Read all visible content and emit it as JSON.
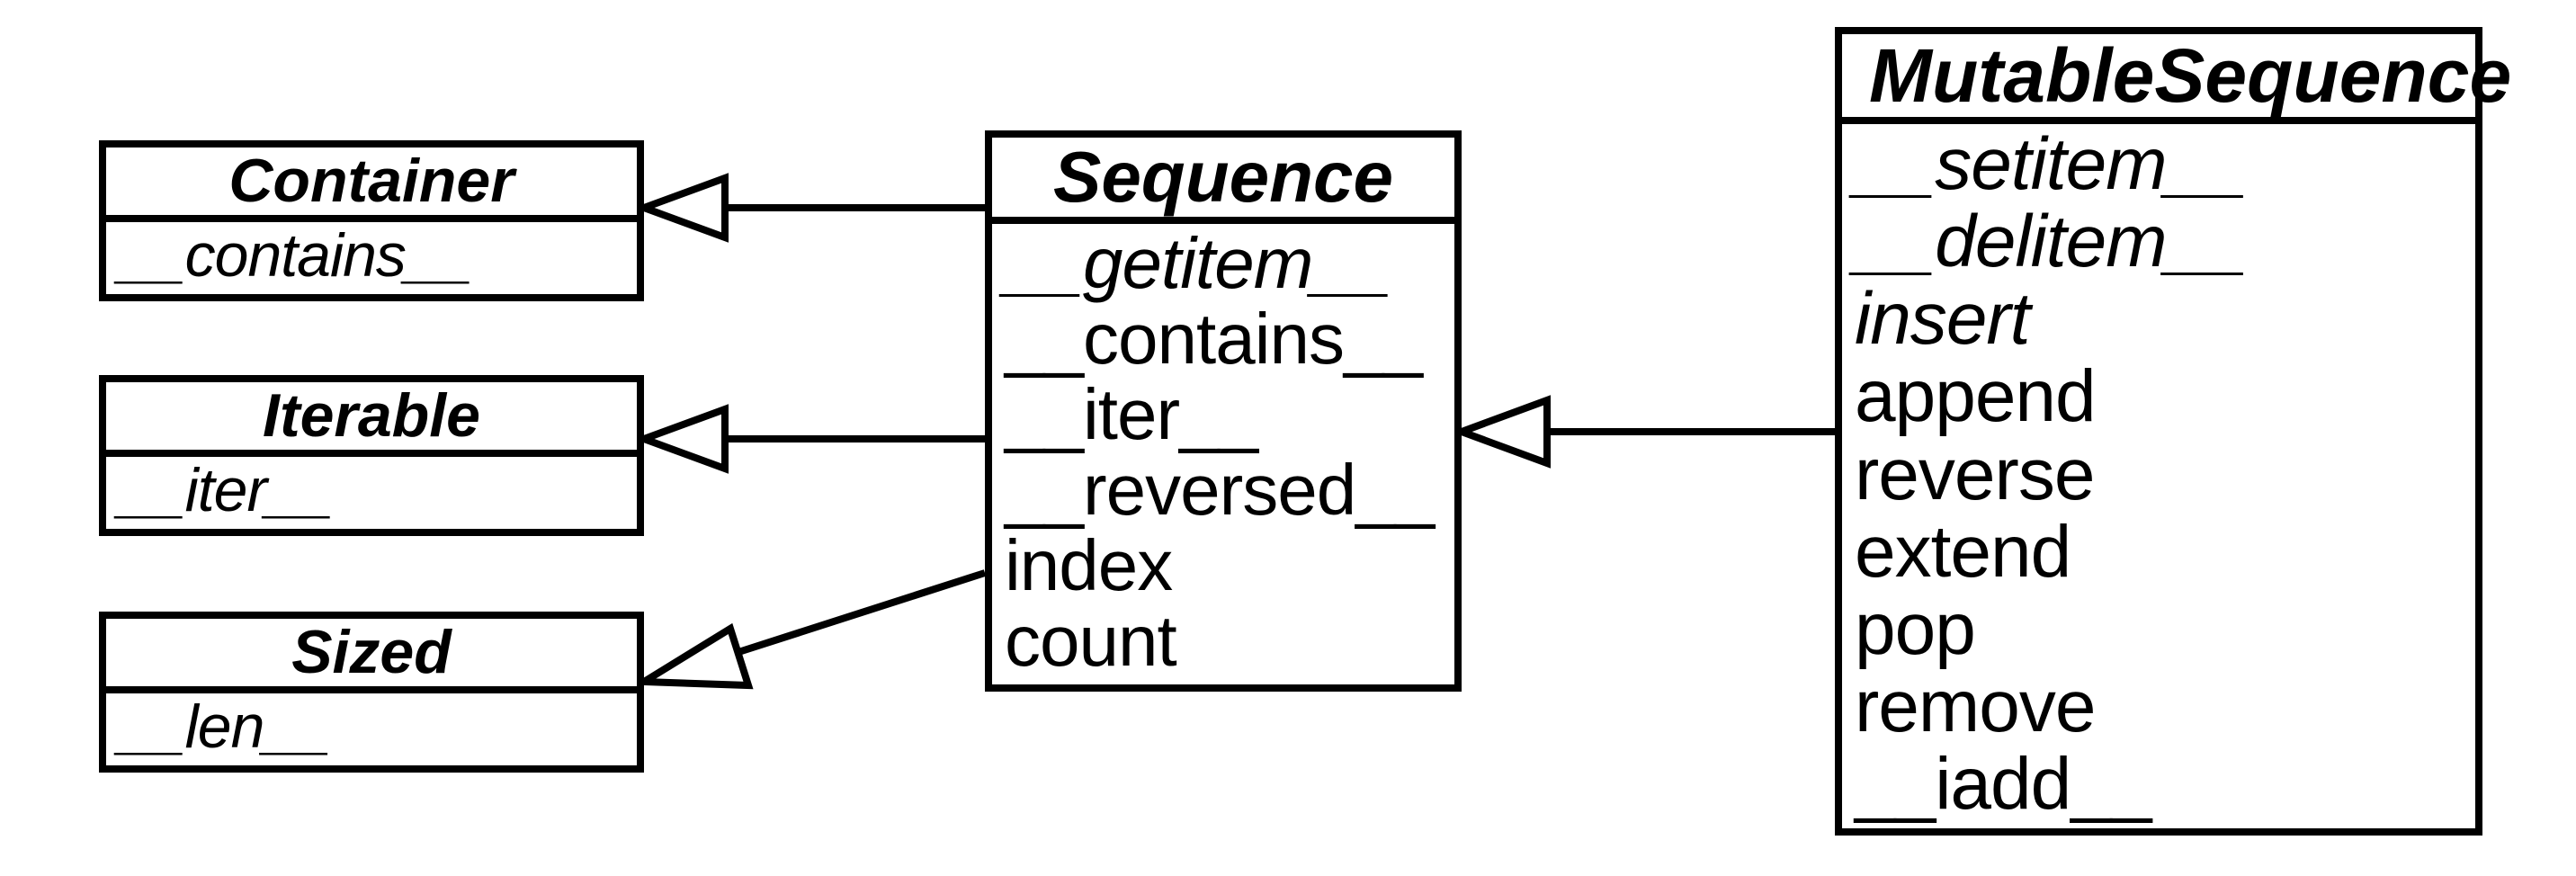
{
  "classes": {
    "container": {
      "name": "Container",
      "members": [
        {
          "text": "__contains__",
          "abstract": true
        }
      ]
    },
    "iterable": {
      "name": "Iterable",
      "members": [
        {
          "text": "__iter__",
          "abstract": true
        }
      ]
    },
    "sized": {
      "name": "Sized",
      "members": [
        {
          "text": "__len__",
          "abstract": true
        }
      ]
    },
    "sequence": {
      "name": "Sequence",
      "members": [
        {
          "text": "__getitem__",
          "abstract": true
        },
        {
          "text": "__contains__",
          "abstract": false
        },
        {
          "text": "__iter__",
          "abstract": false
        },
        {
          "text": "__reversed__",
          "abstract": false
        },
        {
          "text": "index",
          "abstract": false
        },
        {
          "text": "count",
          "abstract": false
        }
      ]
    },
    "mutablesequence": {
      "name": "MutableSequence",
      "members": [
        {
          "text": "__setitem__",
          "abstract": true
        },
        {
          "text": "__delitem__",
          "abstract": true
        },
        {
          "text": "insert",
          "abstract": true
        },
        {
          "text": "append",
          "abstract": false
        },
        {
          "text": "reverse",
          "abstract": false
        },
        {
          "text": "extend",
          "abstract": false
        },
        {
          "text": "pop",
          "abstract": false
        },
        {
          "text": "remove",
          "abstract": false
        },
        {
          "text": "__iadd__",
          "abstract": false
        }
      ]
    }
  }
}
